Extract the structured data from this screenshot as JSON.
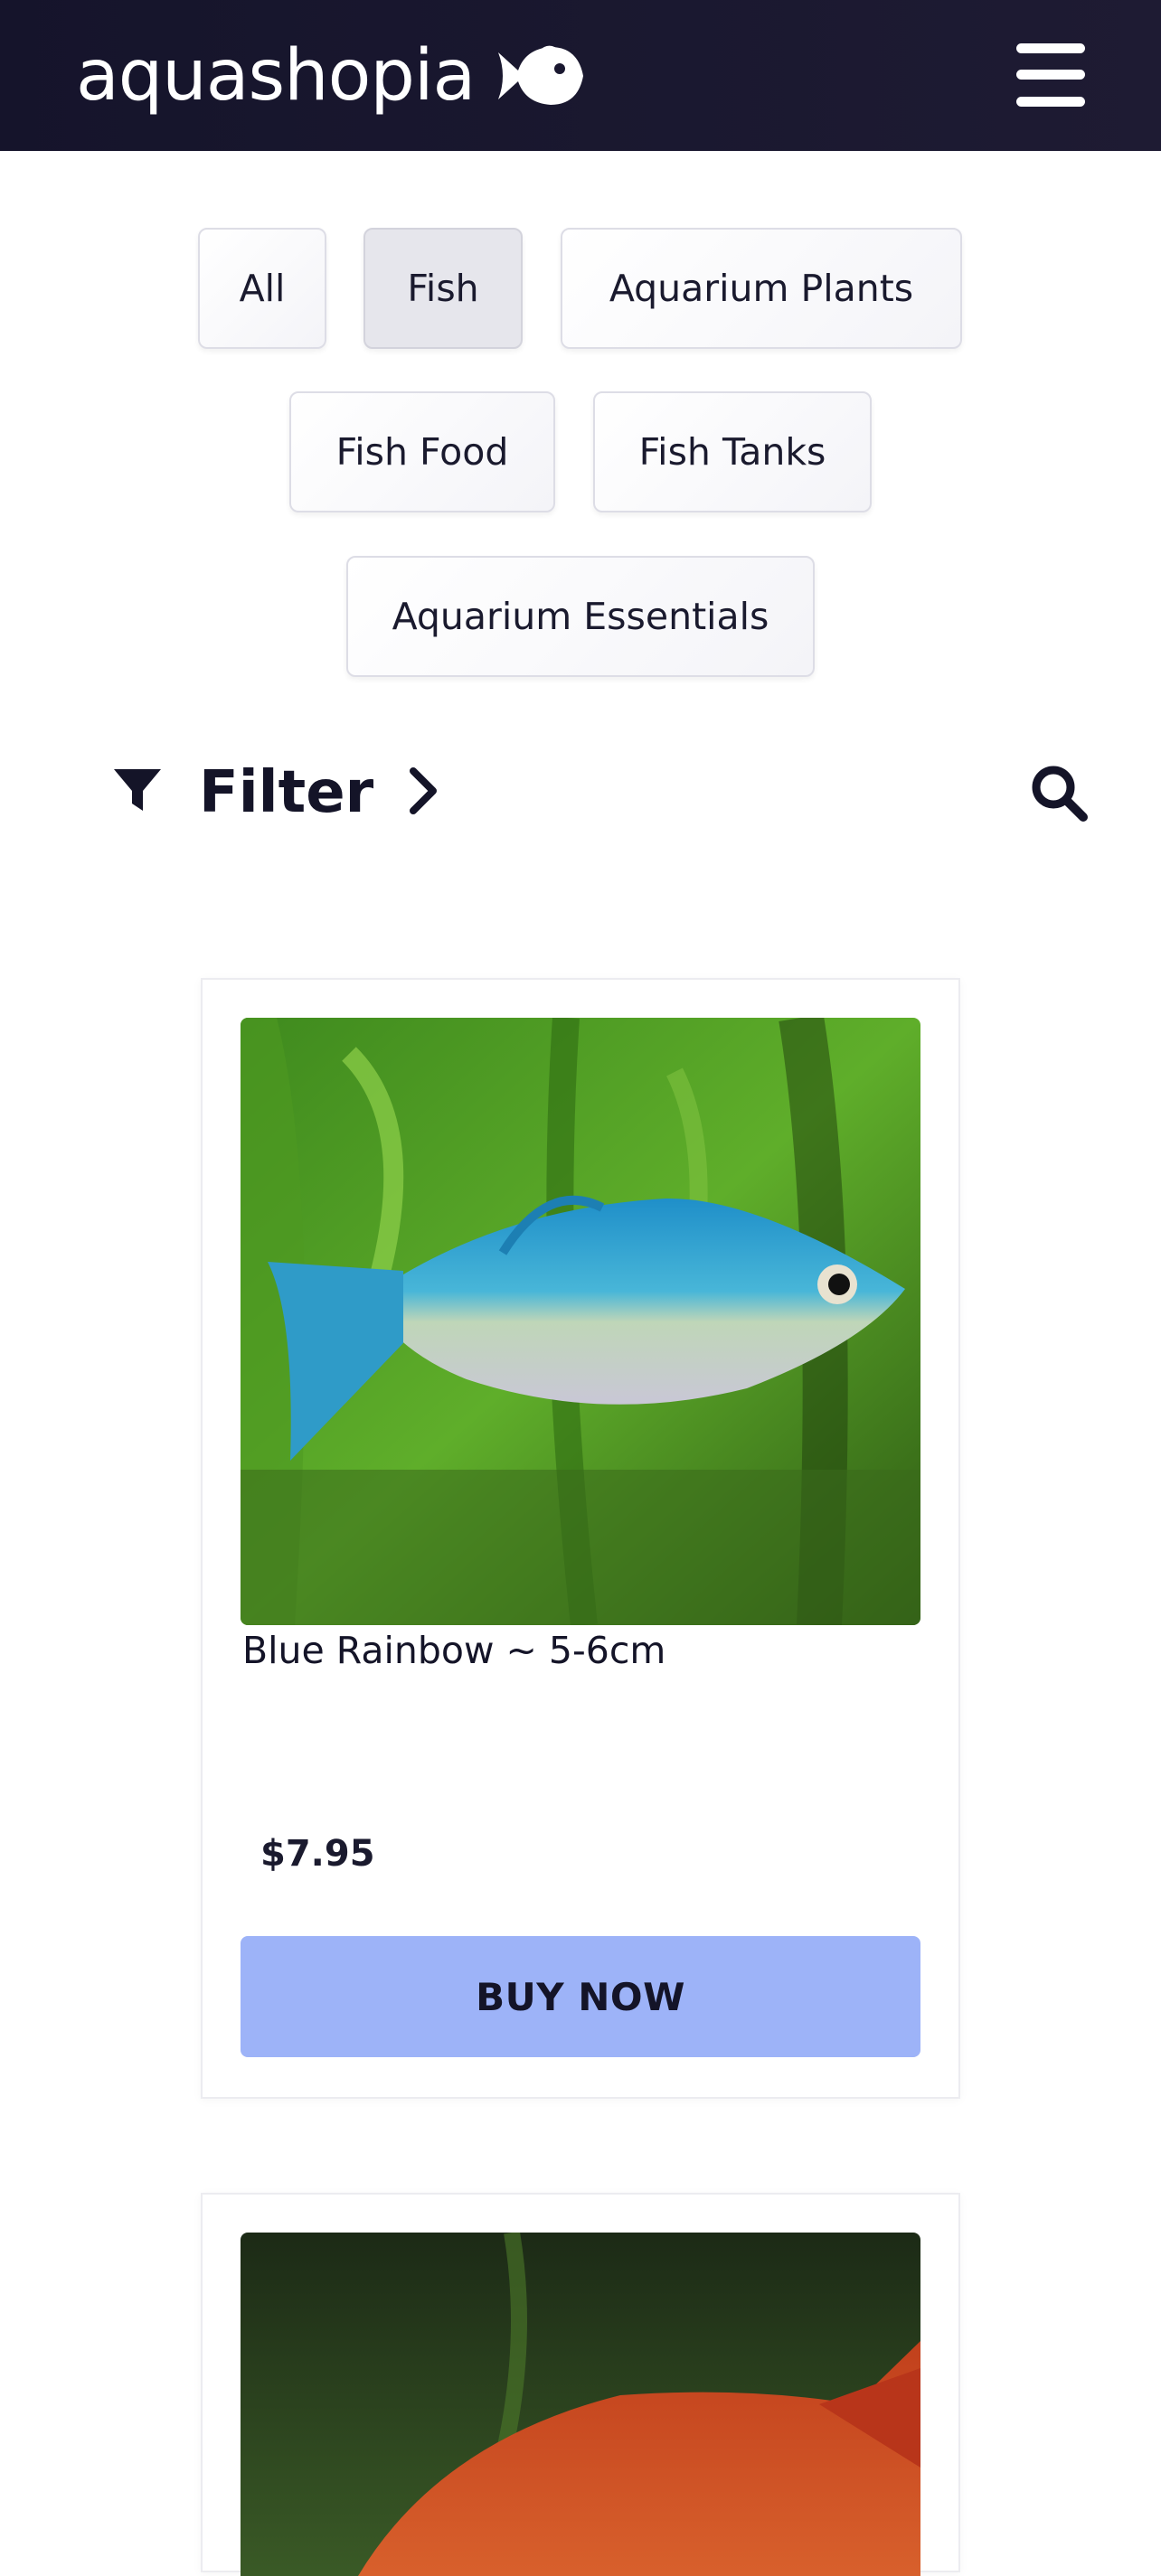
{
  "header": {
    "logo_text": "aquashopia",
    "logo_icon": "fish-icon",
    "menu_icon": "hamburger-menu-icon",
    "background_color": "#1a1830"
  },
  "categories": [
    {
      "label": "All",
      "active": false
    },
    {
      "label": "Fish",
      "active": true
    },
    {
      "label": "Aquarium Plants",
      "active": false
    },
    {
      "label": "Fish Food",
      "active": false
    },
    {
      "label": "Fish Tanks",
      "active": false
    },
    {
      "label": "Aquarium Essentials",
      "active": false
    }
  ],
  "filter": {
    "label": "Filter",
    "icon": "funnel-icon",
    "chevron_icon": "chevron-right-icon",
    "search_icon": "search-icon"
  },
  "products": [
    {
      "name": "Blue Rainbow ~ 5-6cm",
      "price": "$7.95",
      "button_label": "BUY NOW",
      "image": "blue-rainbow-fish-photo"
    },
    {
      "name": "",
      "price": "",
      "button_label": "",
      "image": "red-rainbow-fish-photo"
    }
  ],
  "colors": {
    "accent_button": "#9db3f8",
    "active_pill": "#e6e6ec",
    "text": "#141428"
  }
}
